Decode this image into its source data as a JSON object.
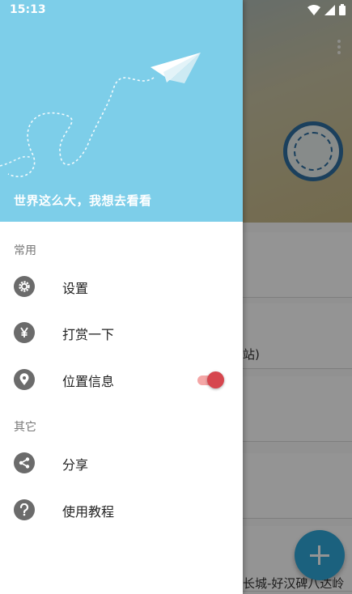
{
  "status_bar": {
    "time": "15:13"
  },
  "drawer": {
    "slogan": "世界这么大，我想去看看",
    "sections": [
      {
        "label": "常用"
      },
      {
        "label": "其它"
      }
    ],
    "items": [
      {
        "label": "设置",
        "icon": "gear-icon"
      },
      {
        "label": "打赏一下",
        "icon": "yen-icon"
      },
      {
        "label": "位置信息",
        "icon": "location-pin-icon",
        "toggle_on": true
      },
      {
        "label": "分享",
        "icon": "share-icon"
      },
      {
        "label": "使用教程",
        "icon": "help-icon"
      }
    ]
  },
  "background": {
    "card_fragments": [
      "站)",
      "长城-好汉碑八达岭"
    ]
  },
  "colors": {
    "header": "#7dcee9",
    "toggle_on": "#d6464e",
    "fab": "#2fa7da"
  }
}
